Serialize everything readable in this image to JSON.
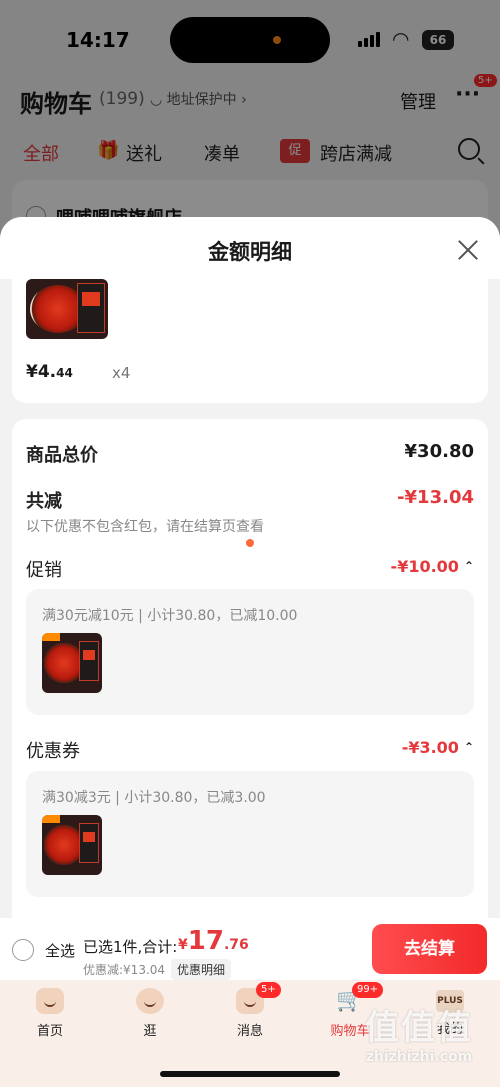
{
  "status_bar": {
    "time": "14:17",
    "battery": "66"
  },
  "cart_header": {
    "title": "购物车",
    "count": "(199)",
    "address_protect": "地址保护中",
    "address_chevron": "›",
    "manage": "管理",
    "more_dots": "···",
    "more_badge": "5+"
  },
  "filter_tabs": {
    "all": "全部",
    "gift": "送礼",
    "bundle": "凑单",
    "promo_tag": "促",
    "cross_store": "跨店满减"
  },
  "shop": {
    "name": "哩哺哩哺旗舰店"
  },
  "sheet": {
    "title": "金额明细",
    "product": {
      "price_int": "¥4.",
      "price_dec": "44",
      "qty": "x4"
    },
    "summary": {
      "total_label": "商品总价",
      "total_value": "¥30.80",
      "reduced_label": "共减",
      "reduced_value": "-¥13.04",
      "hint": "以下优惠不包含红包，请在结算页查看"
    },
    "promotion": {
      "label": "促销",
      "value": "-¥10.00",
      "chevron": "⌃",
      "detail": "满30元减10元 | 小计30.80，已减10.00"
    },
    "coupon": {
      "label": "优惠券",
      "value": "-¥3.00",
      "chevron": "⌃",
      "detail": "满30减3元 | 小计30.80，已减3.00"
    }
  },
  "checkout_bar": {
    "select_all": "全选",
    "selected": "已选1件,合计:",
    "currency": "¥",
    "total_int": "17",
    "total_dec": ".76",
    "discount": "优惠减:¥13.04",
    "detail_link": "优惠明细",
    "checkout": "去结算"
  },
  "tabbar": {
    "home": "首页",
    "browse": "逛",
    "messages": "消息",
    "messages_badge": "5+",
    "cart": "购物车",
    "cart_badge": "99+",
    "me": "我的",
    "plus_label": "PLUS"
  },
  "watermark": {
    "big": "值值值",
    "small": "zhizhizhi.com"
  },
  "colors": {
    "accent": "#e4393c",
    "checkout_gradient_start": "#ff4d4f",
    "tabbar_bg": "#faefe8"
  }
}
